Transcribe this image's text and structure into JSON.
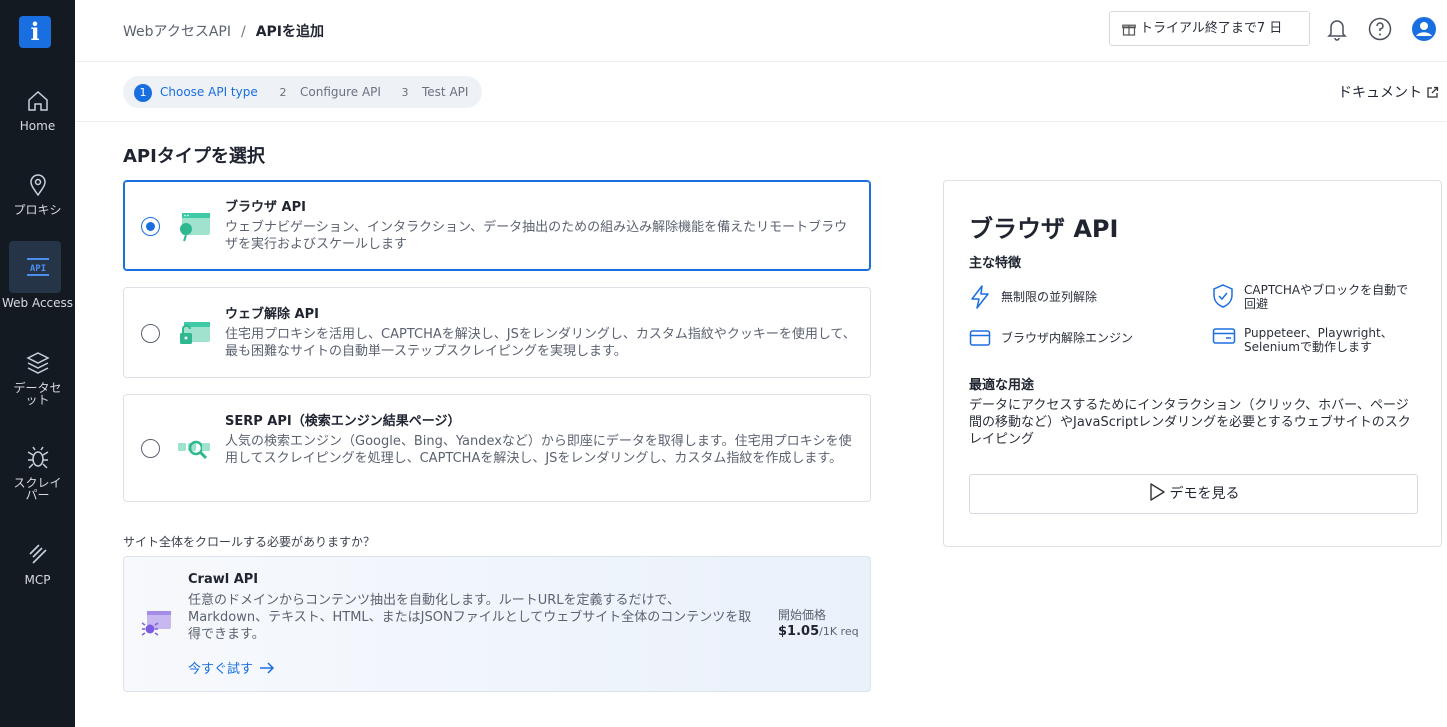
{
  "sidebar": {
    "logo": "i",
    "items": [
      {
        "label": "Home",
        "icon": "home-icon"
      },
      {
        "label": "プロキシ",
        "icon": "location-pin-icon"
      },
      {
        "label": "Web Access",
        "icon": "api-icon",
        "active": true
      },
      {
        "label": "データセット",
        "icon": "database-icon"
      },
      {
        "label": "スクレイパー",
        "icon": "bug-icon"
      },
      {
        "label": "MCP",
        "icon": "mcp-icon"
      }
    ]
  },
  "header": {
    "breadcrumb_parent": "WebアクセスAPI",
    "breadcrumb_sep": "/",
    "breadcrumb_current": "APIを追加",
    "trial_label": "トライアル終了まで7 日",
    "icons": [
      "gift-icon",
      "bell-icon",
      "help-icon",
      "user-icon"
    ]
  },
  "steps": [
    {
      "num": "1",
      "label": "Choose API type",
      "active": true
    },
    {
      "num": "2",
      "label": "Configure API"
    },
    {
      "num": "3",
      "label": "Test API"
    }
  ],
  "doc_link": "ドキュメント",
  "section_title": "APIタイプを選択",
  "cards": [
    {
      "title": "ブラウザ API",
      "desc": "ウェブナビゲーション、インタラクション、データ抽出のための組み込み解除機能を備えたリモートブラウザを実行およびスケールします",
      "selected": true
    },
    {
      "title": "ウェブ解除 API",
      "desc": "住宅用プロキシを活用し、CAPTCHAを解決し、JSをレンダリングし、カスタム指紋やクッキーを使用して、最も困難なサイトの自動単一ステップスクレイピングを実現します。",
      "selected": false
    },
    {
      "title": "SERP API（検索エンジン結果ページ）",
      "desc": "人気の検索エンジン（Google、Bing、Yandexなど）から即座にデータを取得します。住宅用プロキシを使用してスクレイピングを処理し、CAPTCHAを解決し、JSをレンダリングし、カスタム指紋を作成します。",
      "selected": false
    }
  ],
  "crawl": {
    "question": "サイト全体をクロールする必要がありますか？",
    "title": "Crawl API",
    "desc": "任意のドメインからコンテンツ抽出を自動化します。ルートURLを定義するだけで、Markdown、テキスト、HTML、またはJSONファイルとしてウェブサイト全体のコンテンツを取得できます。",
    "try_label": "今すぐ試す",
    "price_label": "開始価格",
    "price": "$1.05",
    "price_unit": "/1K req"
  },
  "panel": {
    "title": "ブラウザ API",
    "features_heading": "主な特徴",
    "features": [
      {
        "label": "無制限の並列解除",
        "icon": "lightning-icon"
      },
      {
        "label": "CAPTCHAやブロックを自動で回避",
        "icon": "shield-check-icon"
      },
      {
        "label": "ブラウザ内解除エンジン",
        "icon": "browser-window-icon"
      },
      {
        "label": "Puppeteer、Playwright、Seleniumで動作します",
        "icon": "id-card-icon"
      }
    ],
    "usecase_heading": "最適な用途",
    "usecase": "データにアクセスするためにインタラクション（クリック、ホバー、ページ間の移動など）やJavaScriptレンダリングを必要とするウェブサイトのスクレイピング",
    "demo_label": "デモを見る"
  },
  "colors": {
    "accent": "#1a6fe0",
    "sidebar": "#141a22",
    "teal": "#3ec9a7"
  }
}
